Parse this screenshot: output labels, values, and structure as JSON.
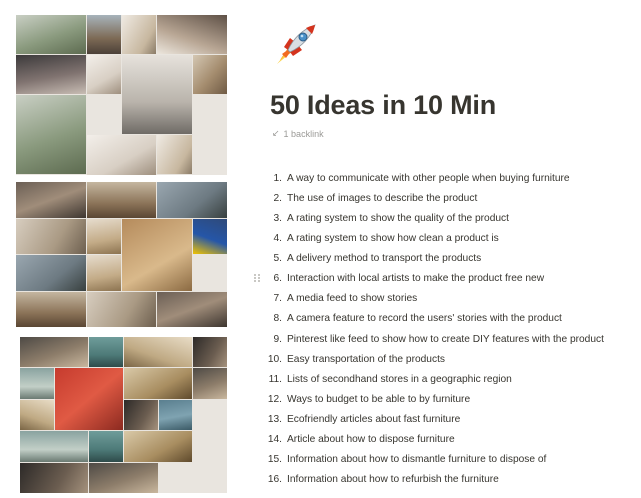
{
  "page": {
    "title": "50 Ideas in 10 Min",
    "icon": "rocket-icon",
    "backlinks_label": "1 backlink"
  },
  "ideas": [
    {
      "number": "1.",
      "text": "A way to communicate with other people when buying furniture"
    },
    {
      "number": "2.",
      "text": "The use of images to describe the product"
    },
    {
      "number": "3.",
      "text": "A rating system to show the quality of the product"
    },
    {
      "number": "4.",
      "text": "A rating system to show how clean a product is"
    },
    {
      "number": "5.",
      "text": "A delivery method to transport the products"
    },
    {
      "number": "6.",
      "text": "Interaction with local artists to make the product free new"
    },
    {
      "number": "7.",
      "text": "A media feed to show stories"
    },
    {
      "number": "8.",
      "text": "A camera feature to record the users' stories with the product"
    },
    {
      "number": "9.",
      "text": "Pinterest like feed to show how to create DIY features with the product"
    },
    {
      "number": "10.",
      "text": "Easy transportation of the products"
    },
    {
      "number": "11.",
      "text": "Lists of secondhand stores in a geographic region"
    },
    {
      "number": "12.",
      "text": "Ways to budget to be able to by furniture"
    },
    {
      "number": "13.",
      "text": "Ecofriendly articles about fast furniture"
    },
    {
      "number": "14.",
      "text": "Article about how to dispose furniture"
    },
    {
      "number": "15.",
      "text": "Information about how to dismantle furniture to dispose of"
    },
    {
      "number": "16.",
      "text": "Information about how to refurbish the furniture"
    }
  ],
  "colors": {
    "text": "#37352f",
    "muted": "#9b9a97",
    "background": "#ffffff"
  }
}
